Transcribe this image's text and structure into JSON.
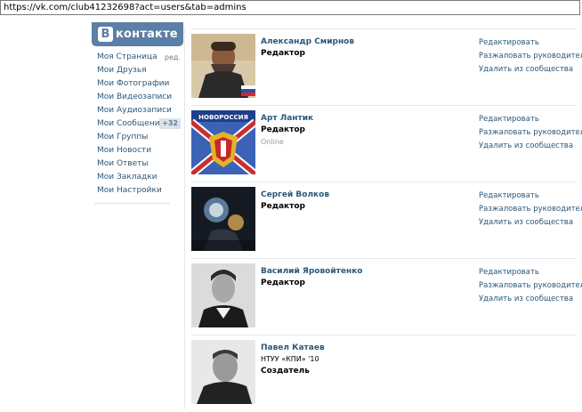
{
  "browser": {
    "url": "https://vk.com/club41232698?act=users&tab=admins"
  },
  "logo": {
    "letter": "В",
    "text": "контакте"
  },
  "menu": {
    "items": [
      {
        "label": "Моя Страница",
        "extra": "ред."
      },
      {
        "label": "Мои Друзья"
      },
      {
        "label": "Мои Фотографии"
      },
      {
        "label": "Мои Видеозаписи"
      },
      {
        "label": "Мои Аудиозаписи"
      },
      {
        "label": "Мои Сообщения",
        "badge": "+32"
      },
      {
        "label": "Мои Группы"
      },
      {
        "label": "Мои Новости"
      },
      {
        "label": "Мои Ответы"
      },
      {
        "label": "Мои Закладки"
      },
      {
        "label": "Мои Настройки"
      }
    ]
  },
  "actions": {
    "edit": "Редактировать",
    "demote": "Разжаловать руководителя",
    "remove": "Удалить из сообщества"
  },
  "members": [
    {
      "name": "Александр Смирнов",
      "role": "Редактор"
    },
    {
      "name": "Арт Лантик",
      "role": "Редактор",
      "status": "Online",
      "avatar_caption": "НОВОРОССИЯ"
    },
    {
      "name": "Сергей Волков",
      "role": "Редактор"
    },
    {
      "name": "Василий Яровойтенко",
      "role": "Редактор"
    },
    {
      "name": "Павел Катаев",
      "info": "НТУУ «КПИ» '10",
      "role": "Создатель"
    }
  ]
}
